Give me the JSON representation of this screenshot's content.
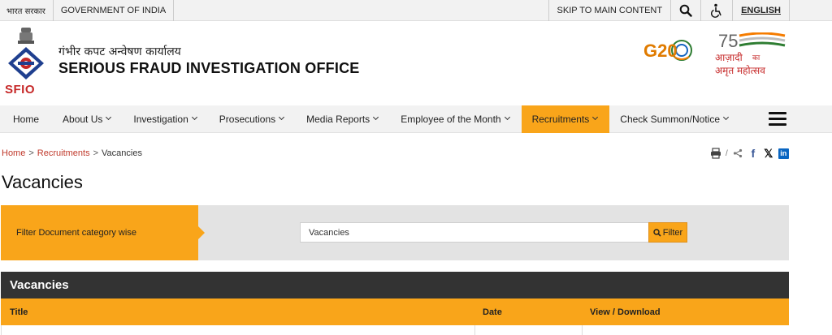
{
  "topbar": {
    "hindi_gov": "भारत सरकार",
    "gov_india": "GOVERNMENT OF INDIA",
    "skip": "SKIP TO MAIN CONTENT",
    "language": "ENGLISH"
  },
  "header": {
    "org_hindi": "गंभीर कपट अन्वेषण कार्यालय",
    "org_english": "SERIOUS FRAUD INVESTIGATION OFFICE",
    "logo_text": "SFIO",
    "g20_text": "G20",
    "azadi_text_1": "आज़ादी",
    "azadi_text_2": "का",
    "azadi_text_3": "अमृत महोत्सव",
    "azadi_number": "75"
  },
  "nav": {
    "items": [
      {
        "label": "Home",
        "has_dropdown": false,
        "active": false
      },
      {
        "label": "About Us",
        "has_dropdown": true,
        "active": false
      },
      {
        "label": "Investigation",
        "has_dropdown": true,
        "active": false
      },
      {
        "label": "Prosecutions",
        "has_dropdown": true,
        "active": false
      },
      {
        "label": "Media Reports",
        "has_dropdown": true,
        "active": false
      },
      {
        "label": "Employee of the Month",
        "has_dropdown": true,
        "active": false
      },
      {
        "label": "Recruitments",
        "has_dropdown": true,
        "active": true
      },
      {
        "label": "Check Summon/Notice",
        "has_dropdown": true,
        "active": false
      }
    ]
  },
  "breadcrumb": {
    "home": "Home",
    "recruitments": "Recruitments",
    "current": "Vacancies",
    "separator": ">"
  },
  "page": {
    "title": "Vacancies"
  },
  "filter": {
    "label": "Filter Document category wise",
    "value": "Vacancies",
    "button_label": "Filter"
  },
  "table": {
    "heading": "Vacancies",
    "columns": [
      "Title",
      "Date",
      "View / Download"
    ]
  },
  "colors": {
    "accent": "#f9a51a",
    "dark_header": "#333333",
    "link": "#c0392b"
  }
}
